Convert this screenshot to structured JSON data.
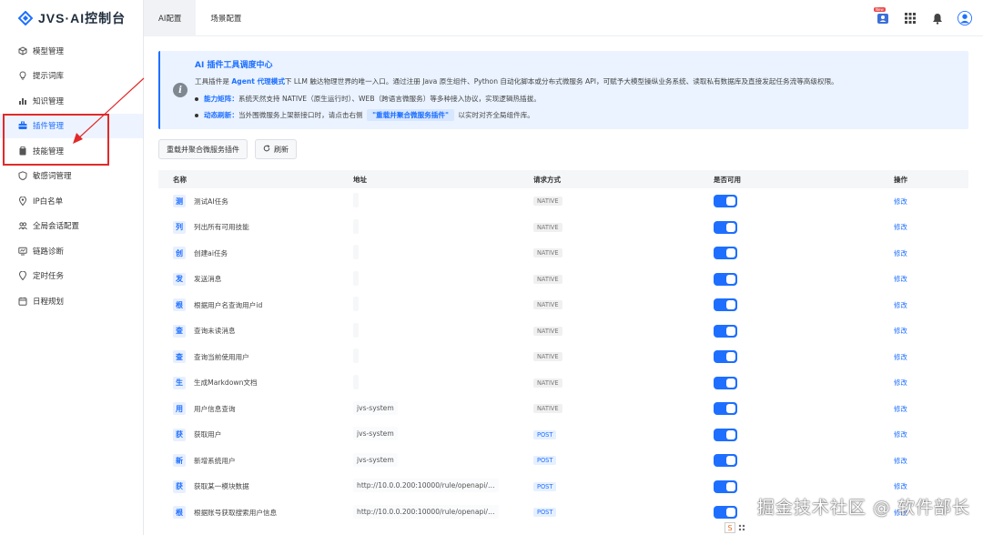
{
  "app": {
    "title": "JVS·AI控制台"
  },
  "sidebar": {
    "items": [
      {
        "label": "模型管理",
        "icon": "cube-icon"
      },
      {
        "label": "提示词库",
        "icon": "bulb-icon"
      },
      {
        "label": "知识管理",
        "icon": "chart-icon"
      },
      {
        "label": "插件管理",
        "icon": "briefcase-icon",
        "active": true
      },
      {
        "label": "技能管理",
        "icon": "clipboard-icon"
      },
      {
        "label": "敏感词管理",
        "icon": "shield-icon"
      },
      {
        "label": "IP白名单",
        "icon": "location-icon"
      },
      {
        "label": "全局会话配置",
        "icon": "people-icon"
      },
      {
        "label": "链路诊断",
        "icon": "monitor-icon"
      },
      {
        "label": "定时任务",
        "icon": "pin-icon"
      },
      {
        "label": "日程规划",
        "icon": "calendar-icon"
      }
    ]
  },
  "topbar": {
    "tabs": [
      {
        "label": "AI配置",
        "active": true
      },
      {
        "label": "场景配置",
        "active": false
      }
    ],
    "badge": "New"
  },
  "notice": {
    "title": "AI 插件工具调度中心",
    "line1_pre": "工具插件是 ",
    "line1_bold": "Agent 代理模式",
    "line1_post": "下 LLM 触达物理世界的唯一入口。通过注册 Java 原生组件、Python 自动化脚本或分布式微服务 API，可赋予大模型操纵业务系统、读取私有数据库及直接发起任务流等高级权限。",
    "line2_bold": "能力矩阵：",
    "line2_text": "系统天然支持 NATIVE（原生运行时）、WEB（跨语言微服务）等多种接入协议，实现逻辑热插拔。",
    "line3_bold": "动态刷新：",
    "line3_text": "当外围微服务上架新接口时，请点击右侧",
    "line3_chip": "\"重载并聚合微服务插件\"",
    "line3_post": "以实时对齐全局组件库。"
  },
  "toolbar": {
    "reload_label": "重载并聚合微服务插件",
    "refresh_label": "刷新"
  },
  "table": {
    "headers": {
      "name": "名称",
      "addr": "地址",
      "method": "请求方式",
      "avail": "是否可用",
      "ops": "操作"
    },
    "edit_label": "修改",
    "rows": [
      {
        "char": "测",
        "name": "测试AI任务",
        "addr": "",
        "method": "NATIVE"
      },
      {
        "char": "列",
        "name": "列出所有可用技能",
        "addr": "",
        "method": "NATIVE"
      },
      {
        "char": "创",
        "name": "创建ai任务",
        "addr": "",
        "method": "NATIVE"
      },
      {
        "char": "发",
        "name": "发送消息",
        "addr": "",
        "method": "NATIVE"
      },
      {
        "char": "根",
        "name": "根据用户名查询用户id",
        "addr": "",
        "method": "NATIVE"
      },
      {
        "char": "查",
        "name": "查询未读消息",
        "addr": "",
        "method": "NATIVE"
      },
      {
        "char": "查",
        "name": "查询当前使用用户",
        "addr": "",
        "method": "NATIVE"
      },
      {
        "char": "生",
        "name": "生成Markdown文档",
        "addr": "",
        "method": "NATIVE"
      },
      {
        "char": "用",
        "name": "用户信息查询",
        "addr": "jvs-system",
        "method": "NATIVE"
      },
      {
        "char": "获",
        "name": "获取用户",
        "addr": "jvs-system",
        "method": "POST"
      },
      {
        "char": "新",
        "name": "新增系统用户",
        "addr": "jvs-system",
        "method": "POST"
      },
      {
        "char": "获",
        "name": "获取某一模块数据",
        "addr": "http://10.0.0.200:10000/rule/openapi/…",
        "method": "POST"
      },
      {
        "char": "根",
        "name": "根据账号获取搜索用户信息",
        "addr": "http://10.0.0.200:10000/rule/openapi/…",
        "method": "POST"
      }
    ]
  },
  "watermark": "掘金技术社区 @ 软件部长"
}
